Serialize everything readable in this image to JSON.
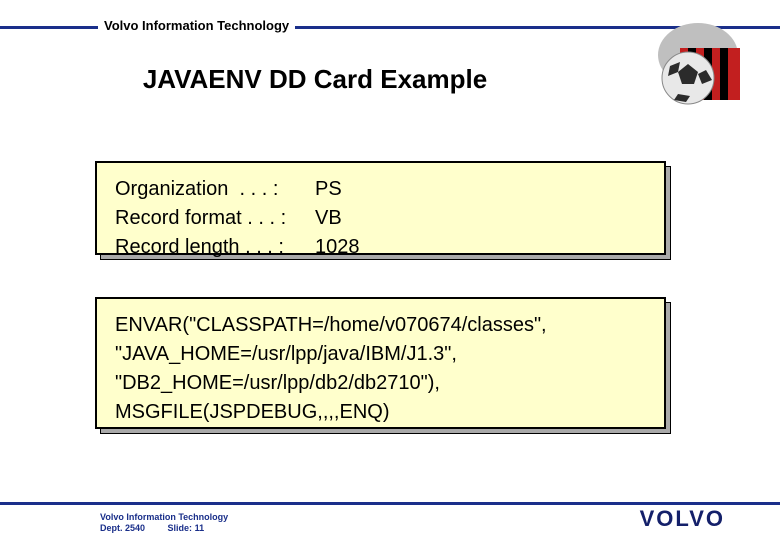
{
  "header": {
    "org_label": "Volvo Information Technology"
  },
  "title": "JAVAENV DD Card Example",
  "attrs": {
    "org_label": "Organization  . . . :",
    "org_value": "PS",
    "fmt_label": "Record format . . . :",
    "fmt_value": "VB",
    "len_label": "Record length . . . :",
    "len_value": "1028"
  },
  "envar": {
    "line1": "ENVAR(\"CLASSPATH=/home/v070674/classes\",",
    "line2": "\"JAVA_HOME=/usr/lpp/java/IBM/J1.3\",",
    "line3": "\"DB2_HOME=/usr/lpp/db2/db2710\"),",
    "line4": "MSGFILE(JSPDEBUG,,,,ENQ)"
  },
  "footer": {
    "line1": "Volvo Information Technology",
    "line2_a": "Dept. 2540",
    "line2_b": "Slide:",
    "slide_no": "11",
    "brand": "VOLVO"
  }
}
